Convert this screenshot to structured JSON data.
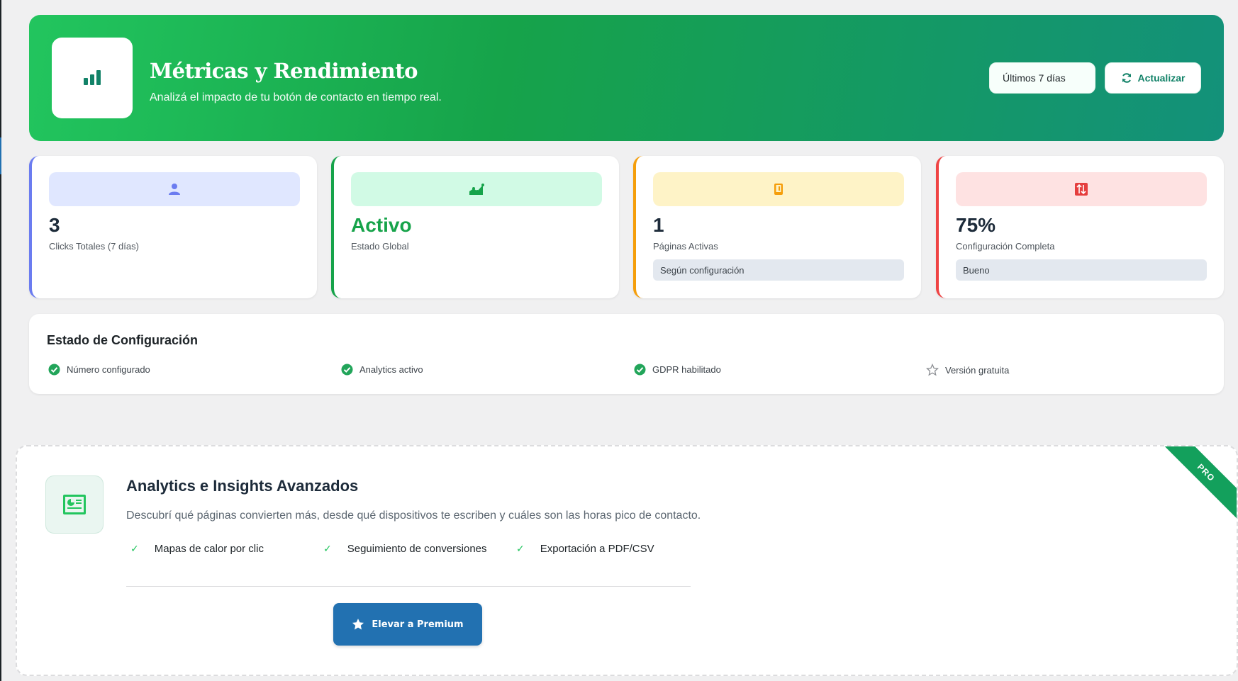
{
  "header": {
    "title": "Métricas y Rendimiento",
    "subtitle": "Analizá el impacto de tu botón de contacto en tiempo real.",
    "period_selected": "Últimos 7 días",
    "refresh_label": "Actualizar",
    "logo_icon": "bar-chart-icon"
  },
  "stats": [
    {
      "icon": "user-icon",
      "value": "3",
      "label": "Clicks Totales (7 días)",
      "accent": "#6b7cf0",
      "band": "#e0e7ff"
    },
    {
      "icon": "trend-up-icon",
      "value": "Activo",
      "label": "Estado Global",
      "accent": "#16a34a",
      "band": "#d1fae5"
    },
    {
      "icon": "mobile-icon",
      "value": "1",
      "label": "Páginas Activas",
      "tag": "Según configuración",
      "accent": "#f59e0b",
      "band": "#fef3c7"
    },
    {
      "icon": "sort-icon",
      "value": "75%",
      "label": "Configuración Completa",
      "tag": "Bueno",
      "accent": "#ef4444",
      "band": "#fee2e2"
    }
  ],
  "config": {
    "title": "Estado de Configuración",
    "items": [
      {
        "label": "Número configurado",
        "icon": "check-circle-icon"
      },
      {
        "label": "Analytics activo",
        "icon": "check-circle-icon"
      },
      {
        "label": "GDPR habilitado",
        "icon": "check-circle-icon"
      },
      {
        "label": "Versión gratuita",
        "icon": "star-outline-icon"
      }
    ]
  },
  "upsell": {
    "title": "Analytics e Insights Avanzados",
    "description": "Descubrí qué páginas convierten más, desde qué dispositivos te escriben y cuáles son las horas pico de contacto.",
    "features": [
      "Mapas de calor por clic",
      "Seguimiento de conversiones",
      "Exportación a PDF/CSV"
    ],
    "cta_label": "Elevar a Premium",
    "ribbon": "PRO"
  },
  "colors": {
    "brand_green": "#22c55e",
    "brand_teal": "#13917a",
    "cta_blue": "#2271b1"
  }
}
